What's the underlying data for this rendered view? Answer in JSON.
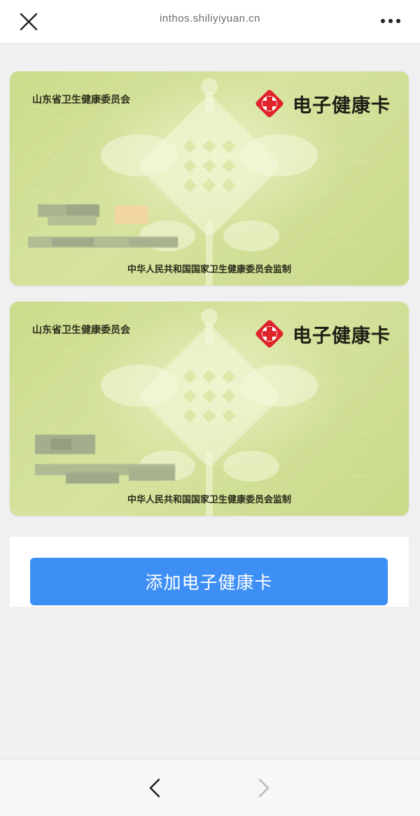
{
  "topbar": {
    "close_icon": "close-icon",
    "url": "inthos.shiliyiyuan.cn",
    "more_icon": "more-icon"
  },
  "cards": [
    {
      "issuer": "山东省卫生健康委员会",
      "brand": "电子健康卡",
      "logo_icon": "red-cross-icon",
      "supervise": "中华人民共和国国家卫生健康委员会监制"
    },
    {
      "issuer": "山东省卫生健康委员会",
      "brand": "电子健康卡",
      "logo_icon": "red-cross-icon",
      "supervise": "中华人民共和国国家卫生健康委员会监制"
    }
  ],
  "actions": {
    "add_card_label": "添加电子健康卡"
  },
  "bottom_nav": {
    "back_icon": "chevron-left-icon",
    "forward_icon": "chevron-right-icon"
  },
  "colors": {
    "accent": "#3d8ff5",
    "card_green": "#cbdc8c",
    "logo_red": "#e0242b"
  }
}
